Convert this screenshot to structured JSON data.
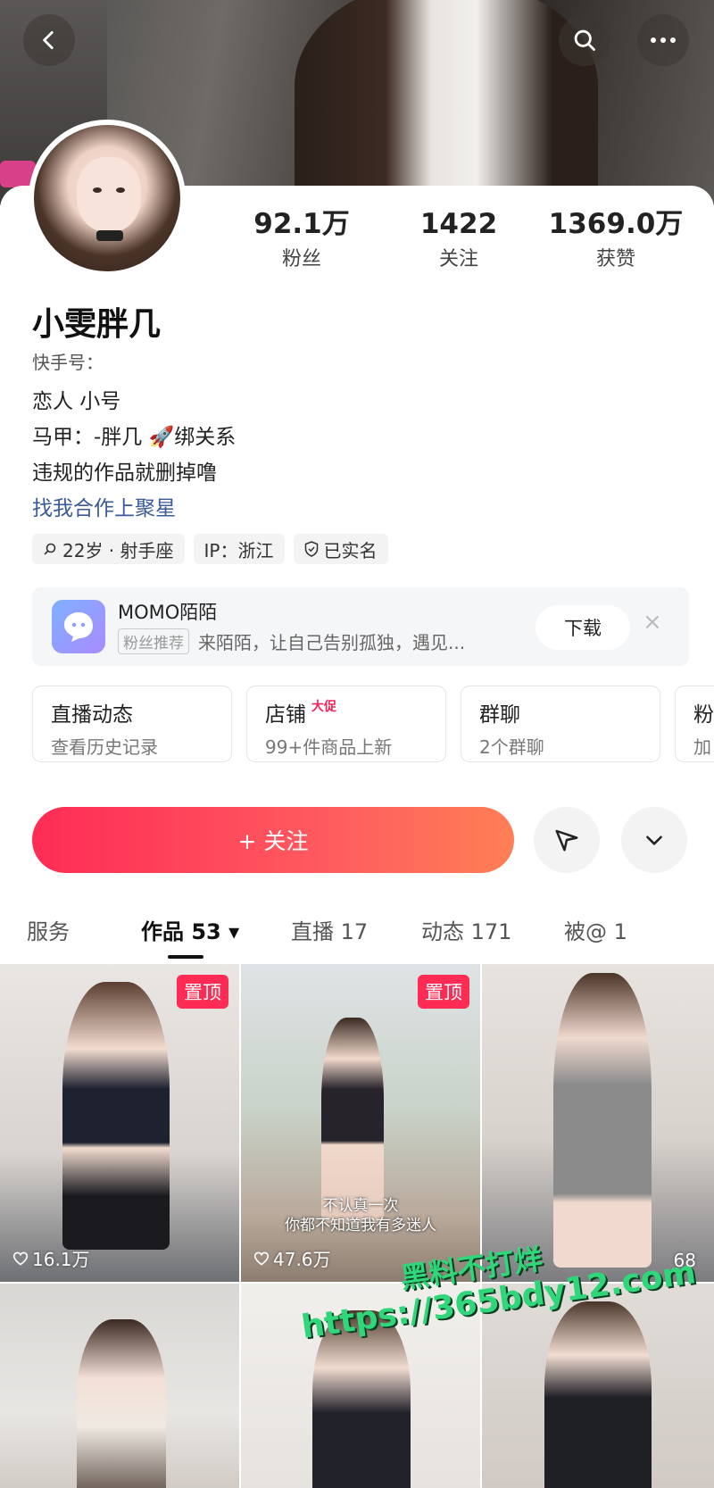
{
  "header": {
    "back_icon": "chevron-left-icon",
    "search_icon": "search-icon",
    "more_icon": "more-horizontal-icon"
  },
  "profile": {
    "name": "小雯胖几",
    "kwai_id_label": "快手号：",
    "bio_lines": [
      "恋人 小号",
      "马甲：-胖几 🚀绑关系",
      "违规的作品就删掉噜"
    ],
    "link_text": "找我合作上聚星",
    "stats": [
      {
        "value": "92.1万",
        "label": "粉丝"
      },
      {
        "value": "1422",
        "label": "关注"
      },
      {
        "value": "1369.0万",
        "label": "获赞"
      }
    ],
    "tags": [
      "22岁 · 射手座",
      "IP：浙江",
      "已实名"
    ]
  },
  "ad": {
    "title": "MOMO陌陌",
    "badge": "粉丝推荐",
    "desc": "来陌陌，让自己告别孤独，遇见...",
    "download_label": "下载",
    "close": "×"
  },
  "info_cards": [
    {
      "title": "直播动态",
      "subtitle": "查看历史记录",
      "promo": ""
    },
    {
      "title": "店铺",
      "subtitle": "99+件商品上新",
      "promo": "大促"
    },
    {
      "title": "群聊",
      "subtitle": "2个群聊",
      "promo": ""
    },
    {
      "title": "粉",
      "subtitle": "加",
      "promo": ""
    }
  ],
  "actions": {
    "follow_label": "+ 关注",
    "share_icon": "send-icon",
    "dropdown_icon": "chevron-down-icon"
  },
  "tabs": [
    {
      "label": "服务"
    },
    {
      "label": "作品 53 ▾"
    },
    {
      "label": "直播 17"
    },
    {
      "label": "动态 171"
    },
    {
      "label": "被@ 1"
    }
  ],
  "videos": [
    {
      "pinned": "置顶",
      "likes": "16.1万",
      "caption": ""
    },
    {
      "pinned": "置顶",
      "likes": "47.6万",
      "caption": "不认真一次\n你都不知道我有多迷人"
    },
    {
      "pinned": "",
      "likes": "68",
      "caption": ""
    },
    {
      "pinned": "",
      "likes": "",
      "caption": ""
    },
    {
      "pinned": "",
      "likes": "",
      "caption": ""
    },
    {
      "pinned": "",
      "likes": "",
      "caption": ""
    }
  ],
  "watermark": {
    "line1": "黑料不打烊",
    "line2": "https://365bdy12.com"
  },
  "colors": {
    "accent": "#fe2c55",
    "link": "#3a5a9a",
    "watermark": "#30d67a"
  }
}
